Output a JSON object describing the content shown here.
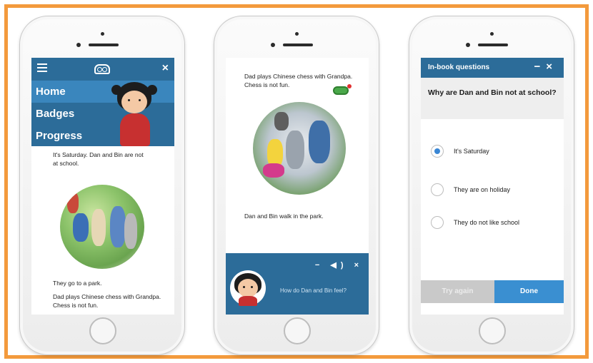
{
  "phone1": {
    "menu": {
      "items": [
        "Home",
        "Badges",
        "Progress"
      ],
      "close": "×",
      "hamburger_icon": "menu-icon",
      "logo_icon": "book-logo-icon"
    },
    "story": {
      "line1": "It's Saturday. Dan and Bin are not",
      "line2": "at school.",
      "line3": "They go to a park.",
      "line4": "Dad plays Chinese chess with Grandpa.",
      "line5": "Chess is not fun."
    }
  },
  "phone2": {
    "story": {
      "line1": "Dad plays Chinese chess with Grandpa.",
      "line2": "Chess is not fun.",
      "line3": "Dan and Bin walk in the park."
    },
    "audio": {
      "question": "How do Dan and Bin feel?",
      "minimize": "−",
      "speaker_icon": "speaker-icon",
      "close": "×"
    }
  },
  "phone3": {
    "header": {
      "title": "In-book questions",
      "minimize": "−",
      "close": "×"
    },
    "question": "Why are Dan and Bin not at school?",
    "options": [
      "It's Saturday",
      "They are on holiday",
      "They do not like school"
    ],
    "selected_index": 0,
    "buttons": {
      "try_again": "Try again",
      "done": "Done"
    }
  },
  "colors": {
    "frame": "#f39a3c",
    "accent_blue": "#2c6c99",
    "done_blue": "#3a8fd1"
  }
}
